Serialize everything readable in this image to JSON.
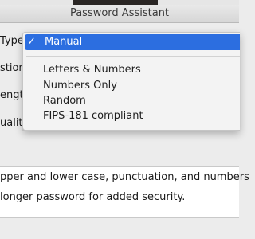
{
  "window": {
    "title": "Password Assistant"
  },
  "labels": {
    "type": "Type",
    "suggestion": "stion",
    "length": "ength",
    "quality": "uality"
  },
  "menu": {
    "selected": "Manual",
    "items": [
      "Letters & Numbers",
      "Numbers Only",
      "Random",
      "FIPS-181 compliant"
    ]
  },
  "tips": {
    "line1": "pper and lower case, punctuation, and numbers",
    "line2": "longer password for added security."
  },
  "colors": {
    "selection": "#2c6ee0",
    "window_bg": "#ececec"
  }
}
